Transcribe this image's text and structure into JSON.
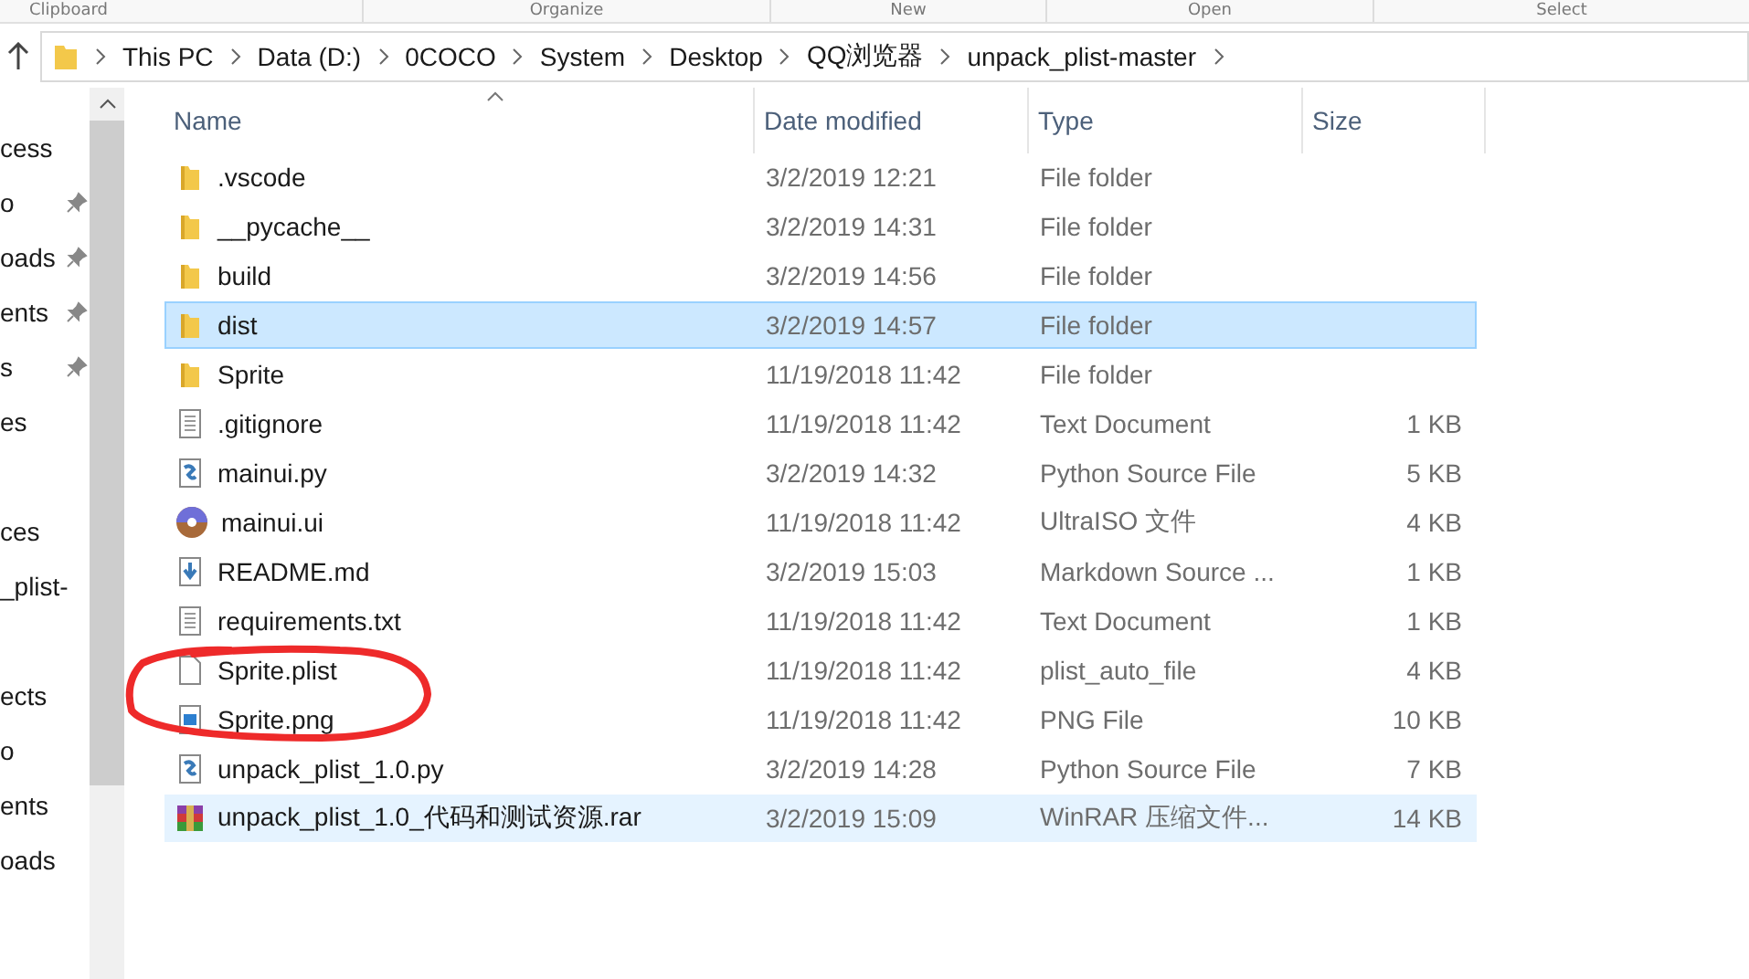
{
  "ribbon_groups": [
    "Clipboard",
    "Organize",
    "New",
    "Open",
    "Select"
  ],
  "address_bar": {
    "crumbs": [
      "This PC",
      "Data (D:)",
      "0COCO",
      "System",
      "Desktop",
      "QQ浏览器",
      "unpack_plist-master"
    ]
  },
  "sidebar": {
    "items": [
      {
        "label": "cess",
        "pinned": false
      },
      {
        "label": "o",
        "pinned": true
      },
      {
        "label": "oads",
        "pinned": true
      },
      {
        "label": "ents",
        "pinned": true
      },
      {
        "label": "s",
        "pinned": true
      },
      {
        "label": "es",
        "pinned": false
      },
      {
        "pinned": false
      },
      {
        "label": "ces",
        "pinned": false
      },
      {
        "label": "_plist-",
        "pinned": false
      },
      {
        "pinned": false
      },
      {
        "label": "ects",
        "pinned": false
      },
      {
        "label": "o",
        "pinned": false
      },
      {
        "label": "ents",
        "pinned": false
      },
      {
        "label": "oads",
        "pinned": false
      }
    ]
  },
  "table": {
    "columns": [
      "Name",
      "Date modified",
      "Type",
      "Size"
    ],
    "rows": [
      {
        "kind": "folder",
        "name": ".vscode",
        "date": "3/2/2019 12:21",
        "type": "File folder",
        "size": "",
        "selected": false,
        "hovered": false
      },
      {
        "kind": "folder",
        "name": "__pycache__",
        "date": "3/2/2019 14:31",
        "type": "File folder",
        "size": "",
        "selected": false,
        "hovered": false
      },
      {
        "kind": "folder",
        "name": "build",
        "date": "3/2/2019 14:56",
        "type": "File folder",
        "size": "",
        "selected": false,
        "hovered": false
      },
      {
        "kind": "folder",
        "name": "dist",
        "date": "3/2/2019 14:57",
        "type": "File folder",
        "size": "",
        "selected": true,
        "hovered": false
      },
      {
        "kind": "folder",
        "name": "Sprite",
        "date": "11/19/2018 11:42",
        "type": "File folder",
        "size": "",
        "selected": false,
        "hovered": false
      },
      {
        "kind": "text",
        "name": ".gitignore",
        "date": "11/19/2018 11:42",
        "type": "Text Document",
        "size": "1 KB",
        "selected": false,
        "hovered": false
      },
      {
        "kind": "python",
        "name": "mainui.py",
        "date": "3/2/2019 14:32",
        "type": "Python Source File",
        "size": "5 KB",
        "selected": false,
        "hovered": false
      },
      {
        "kind": "disc",
        "name": "mainui.ui",
        "date": "11/19/2018 11:42",
        "type": "UltraISO 文件",
        "size": "4 KB",
        "selected": false,
        "hovered": false
      },
      {
        "kind": "markdown",
        "name": "README.md",
        "date": "3/2/2019 15:03",
        "type": "Markdown Source ...",
        "size": "1 KB",
        "selected": false,
        "hovered": false
      },
      {
        "kind": "text",
        "name": "requirements.txt",
        "date": "11/19/2018 11:42",
        "type": "Text Document",
        "size": "1 KB",
        "selected": false,
        "hovered": false
      },
      {
        "kind": "blank",
        "name": "Sprite.plist",
        "date": "11/19/2018 11:42",
        "type": "plist_auto_file",
        "size": "4 KB",
        "selected": false,
        "hovered": false
      },
      {
        "kind": "image",
        "name": "Sprite.png",
        "date": "11/19/2018 11:42",
        "type": "PNG File",
        "size": "10 KB",
        "selected": false,
        "hovered": false
      },
      {
        "kind": "python",
        "name": "unpack_plist_1.0.py",
        "date": "3/2/2019 14:28",
        "type": "Python Source File",
        "size": "7 KB",
        "selected": false,
        "hovered": false
      },
      {
        "kind": "rar",
        "name": "unpack_plist_1.0_代码和测试资源.rar",
        "date": "3/2/2019 15:09",
        "type": "WinRAR 压缩文件...",
        "size": "14 KB",
        "selected": false,
        "hovered": true
      }
    ]
  }
}
